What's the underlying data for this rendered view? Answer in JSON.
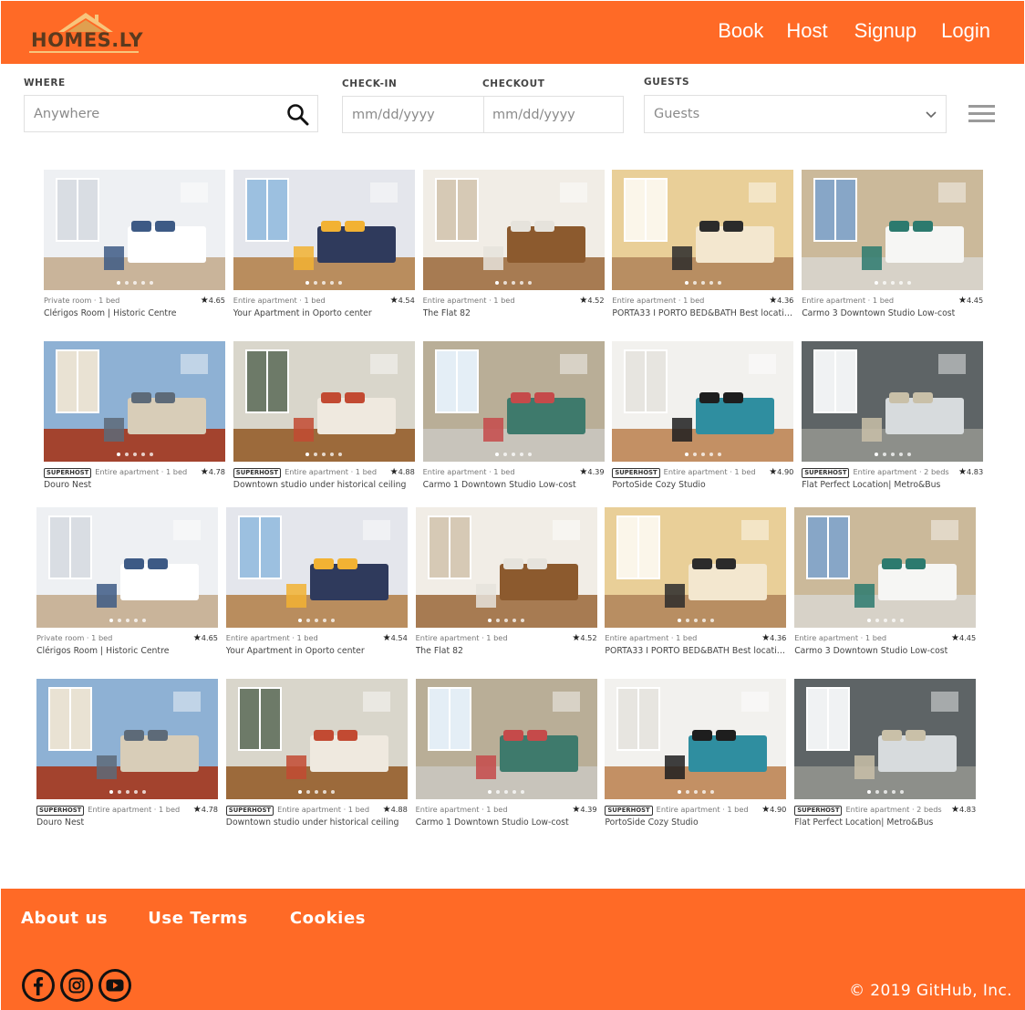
{
  "header": {
    "logo_text": "HOMES.LY",
    "nav": [
      "Book",
      "Host",
      "Signup",
      "Login"
    ],
    "background": "#ff6a26"
  },
  "search": {
    "where_label": "WHERE",
    "where_placeholder": "Anywhere",
    "checkin_label": "CHECK-IN",
    "checkout_label": "CHECKOUT",
    "checkin_placeholder": "mm/dd/yyyy",
    "checkout_placeholder": "mm/dd/yyyy",
    "guests_label": "GUESTS",
    "guests_value": "Guests"
  },
  "listings": [
    {
      "superhost": false,
      "type": "Private room · 1 bed",
      "rating": "4.65",
      "name": "Clérigos Room | Historic Centre",
      "scene": "white"
    },
    {
      "superhost": false,
      "type": "Entire apartment · 1 bed",
      "rating": "4.54",
      "name": "Your Apartment in Oporto center",
      "scene": "living"
    },
    {
      "superhost": false,
      "type": "Entire apartment · 1 bed",
      "rating": "4.52",
      "name": "The Flat 82",
      "scene": "bedroom"
    },
    {
      "superhost": false,
      "type": "Entire apartment · 1 bed",
      "rating": "4.36",
      "name": "PORTA33 I PORTO BED&BATH Best location...",
      "scene": "beige"
    },
    {
      "superhost": false,
      "type": "Entire apartment · 1 bed",
      "rating": "4.45",
      "name": "Carmo 3 Downtown Studio Low-cost",
      "scene": "stone"
    },
    {
      "superhost": true,
      "type": "Entire apartment · 1 bed",
      "rating": "4.78",
      "name": "Douro Nest",
      "scene": "city"
    },
    {
      "superhost": true,
      "type": "Entire apartment · 1 bed",
      "rating": "4.88",
      "name": "Downtown studio under historical ceiling",
      "scene": "studio"
    },
    {
      "superhost": false,
      "type": "Entire apartment · 1 bed",
      "rating": "4.39",
      "name": "Carmo 1 Downtown Studio Low-cost",
      "scene": "window"
    },
    {
      "superhost": true,
      "type": "Entire apartment · 1 bed",
      "rating": "4.90",
      "name": "PortoSide Cozy Studio",
      "scene": "teal"
    },
    {
      "superhost": true,
      "type": "Entire apartment · 2 beds",
      "rating": "4.83",
      "name": "Flat Perfect Location| Metro&Bus",
      "scene": "dark"
    },
    {
      "superhost": false,
      "type": "Private room · 1 bed",
      "rating": "4.65",
      "name": "Clérigos Room | Historic Centre",
      "scene": "white"
    },
    {
      "superhost": false,
      "type": "Entire apartment · 1 bed",
      "rating": "4.54",
      "name": "Your Apartment in Oporto center",
      "scene": "living"
    },
    {
      "superhost": false,
      "type": "Entire apartment · 1 bed",
      "rating": "4.52",
      "name": "The Flat 82",
      "scene": "bedroom"
    },
    {
      "superhost": false,
      "type": "Entire apartment · 1 bed",
      "rating": "4.36",
      "name": "PORTA33 I PORTO BED&BATH Best location...",
      "scene": "beige"
    },
    {
      "superhost": false,
      "type": "Entire apartment · 1 bed",
      "rating": "4.45",
      "name": "Carmo 3 Downtown Studio Low-cost",
      "scene": "stone"
    },
    {
      "superhost": true,
      "type": "Entire apartment · 1 bed",
      "rating": "4.78",
      "name": "Douro Nest",
      "scene": "city"
    },
    {
      "superhost": true,
      "type": "Entire apartment · 1 bed",
      "rating": "4.88",
      "name": "Downtown studio under historical ceiling",
      "scene": "studio"
    },
    {
      "superhost": false,
      "type": "Entire apartment · 1 bed",
      "rating": "4.39",
      "name": "Carmo 1 Downtown Studio Low-cost",
      "scene": "window"
    },
    {
      "superhost": true,
      "type": "Entire apartment · 1 bed",
      "rating": "4.90",
      "name": "PortoSide Cozy Studio",
      "scene": "teal"
    },
    {
      "superhost": true,
      "type": "Entire apartment · 2 beds",
      "rating": "4.83",
      "name": "Flat Perfect Location| Metro&Bus",
      "scene": "dark"
    }
  ],
  "superhost_label": "SUPERHOST",
  "footer": {
    "links": [
      "About us",
      "Use Terms",
      "Cookies"
    ],
    "social": [
      "facebook-icon",
      "instagram-icon",
      "youtube-icon"
    ],
    "copyright": "© 2019 GitHub, Inc."
  }
}
